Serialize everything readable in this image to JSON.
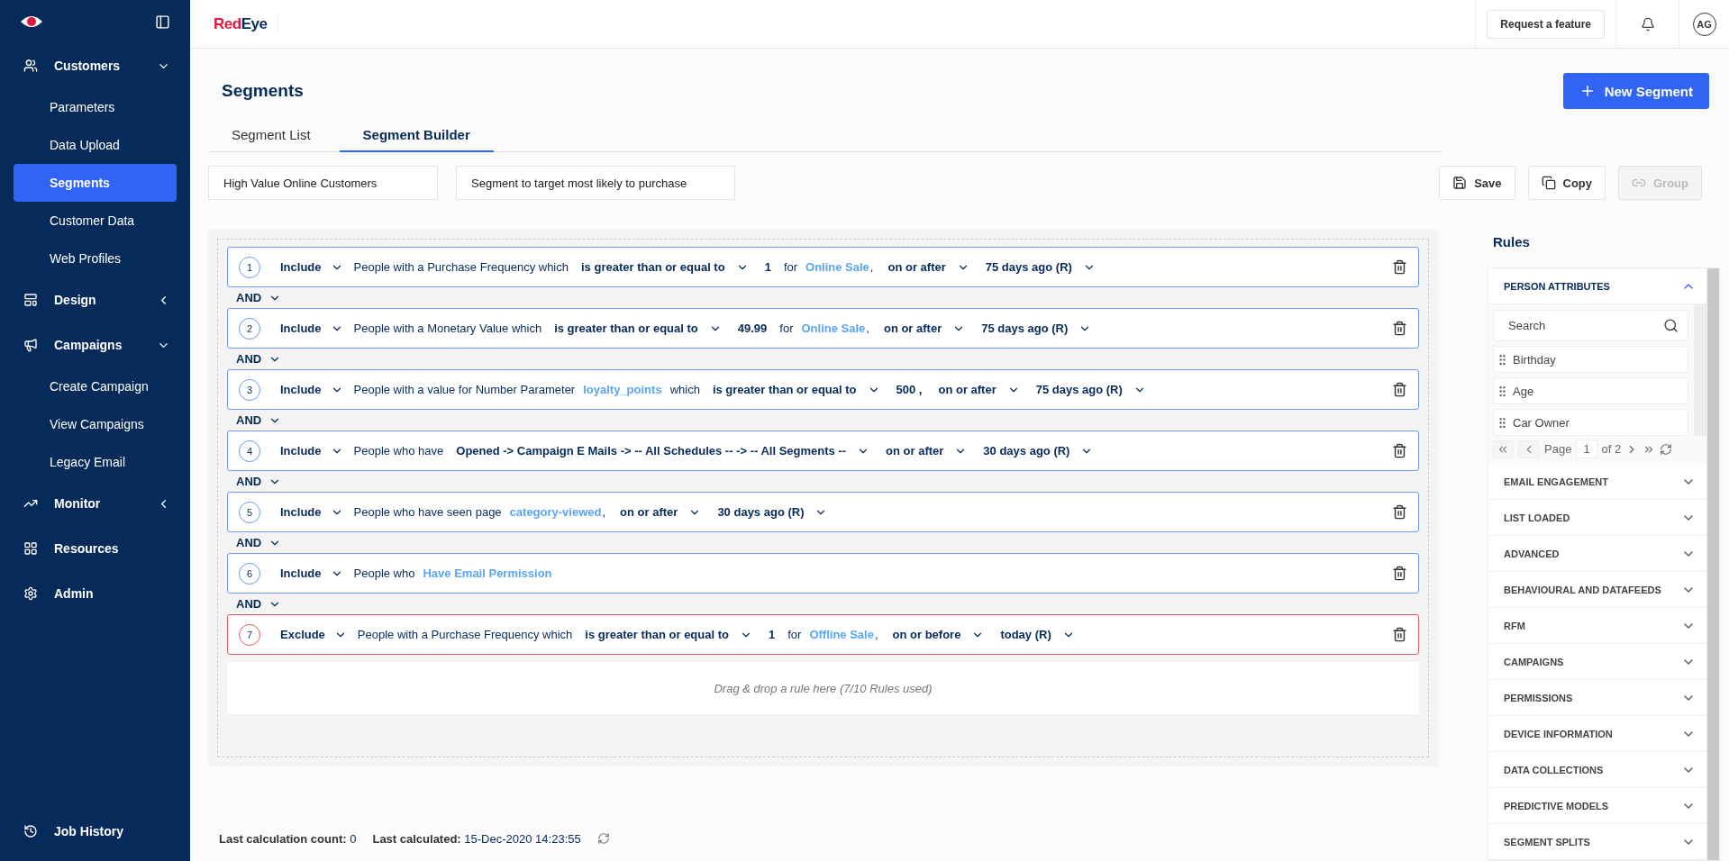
{
  "sidebar": {
    "sections": [
      {
        "label": "Customers",
        "expanded": true,
        "children": [
          {
            "label": "Parameters",
            "selected": false
          },
          {
            "label": "Data Upload",
            "selected": false
          },
          {
            "label": "Segments",
            "selected": true
          },
          {
            "label": "Customer Data",
            "selected": false
          },
          {
            "label": "Web Profiles",
            "selected": false
          }
        ]
      },
      {
        "label": "Design",
        "expanded": false
      },
      {
        "label": "Campaigns",
        "expanded": true,
        "children": [
          {
            "label": "Create Campaign",
            "selected": false
          },
          {
            "label": "View Campaigns",
            "selected": false
          },
          {
            "label": "Legacy Email",
            "selected": false
          }
        ]
      },
      {
        "label": "Monitor",
        "expanded": false
      },
      {
        "label": "Resources"
      },
      {
        "label": "Admin"
      }
    ],
    "footer": "Job History"
  },
  "header": {
    "brand": [
      "Red",
      "Eye"
    ],
    "request_button": "Request a feature",
    "avatar": "AG"
  },
  "page": {
    "title": "Segments",
    "new_button": "New Segment",
    "tabs": [
      {
        "label": "Segment List",
        "selected": false
      },
      {
        "label": "Segment Builder",
        "selected": true
      }
    ],
    "name_field": "High Value Online Customers",
    "description_field": "Segment to target most likely to purchase",
    "actions": [
      {
        "label": "Save",
        "disabled": false
      },
      {
        "label": "Copy",
        "disabled": false
      },
      {
        "label": "Group",
        "disabled": true
      }
    ]
  },
  "rules": [
    {
      "number": "1",
      "kind": "include",
      "mode": "Include",
      "join": "AND",
      "parts": [
        {
          "kind": "plain",
          "text": "People with a Purchase Frequency which"
        },
        {
          "kind": "select",
          "text": "is greater than or equal to"
        },
        {
          "kind": "value",
          "text": "1"
        },
        {
          "kind": "plain",
          "text": "for"
        },
        {
          "kind": "link",
          "text": "Online Sale"
        },
        {
          "kind": "punct",
          "text": ","
        },
        {
          "kind": "select",
          "text": "on or after"
        },
        {
          "kind": "select",
          "text": "75 days ago (R)"
        }
      ]
    },
    {
      "number": "2",
      "kind": "include",
      "mode": "Include",
      "join": "AND",
      "parts": [
        {
          "kind": "plain",
          "text": "People with a Monetary Value which"
        },
        {
          "kind": "select",
          "text": "is greater than or equal to"
        },
        {
          "kind": "value",
          "text": "49.99"
        },
        {
          "kind": "plain",
          "text": "for"
        },
        {
          "kind": "link",
          "text": "Online Sale"
        },
        {
          "kind": "punct",
          "text": ","
        },
        {
          "kind": "select",
          "text": "on or after"
        },
        {
          "kind": "select",
          "text": "75 days ago (R)"
        }
      ]
    },
    {
      "number": "3",
      "kind": "include",
      "mode": "Include",
      "join": "AND",
      "parts": [
        {
          "kind": "plain",
          "text": "People with a value for Number Parameter"
        },
        {
          "kind": "link",
          "text": "loyalty_points"
        },
        {
          "kind": "plain",
          "text": "which"
        },
        {
          "kind": "select",
          "text": "is greater than or equal to"
        },
        {
          "kind": "value",
          "text": "500 ,"
        },
        {
          "kind": "select",
          "text": "on or after"
        },
        {
          "kind": "select",
          "text": "75 days ago (R)"
        }
      ]
    },
    {
      "number": "4",
      "kind": "include",
      "mode": "Include",
      "join": "AND",
      "parts": [
        {
          "kind": "plain",
          "text": "People who have"
        },
        {
          "kind": "select",
          "text": "Opened -> Campaign E Mails -> -- All Schedules -- -> -- All Segments --"
        },
        {
          "kind": "select",
          "text": "on or after"
        },
        {
          "kind": "select",
          "text": "30 days ago (R)"
        }
      ]
    },
    {
      "number": "5",
      "kind": "include",
      "mode": "Include",
      "join": "AND",
      "parts": [
        {
          "kind": "plain",
          "text": "People who have seen page"
        },
        {
          "kind": "link",
          "text": "category-viewed"
        },
        {
          "kind": "punct",
          "text": ","
        },
        {
          "kind": "select",
          "text": "on or after"
        },
        {
          "kind": "select",
          "text": "30 days ago (R)"
        }
      ]
    },
    {
      "number": "6",
      "kind": "include",
      "mode": "Include",
      "join": "AND",
      "parts": [
        {
          "kind": "plain",
          "text": "People who"
        },
        {
          "kind": "link",
          "text": "Have Email Permission"
        }
      ]
    },
    {
      "number": "7",
      "kind": "exclude",
      "mode": "Exclude",
      "parts": [
        {
          "kind": "plain",
          "text": "People with a Purchase Frequency which"
        },
        {
          "kind": "select",
          "text": "is greater than or equal to"
        },
        {
          "kind": "value",
          "text": "1"
        },
        {
          "kind": "plain",
          "text": "for"
        },
        {
          "kind": "link",
          "text": "Offline Sale"
        },
        {
          "kind": "punct",
          "text": ","
        },
        {
          "kind": "select",
          "text": "on or before"
        },
        {
          "kind": "select",
          "text": "today (R)"
        }
      ]
    }
  ],
  "drop_hint": "Drag & drop a rule here (7/10 Rules used)",
  "status_bar": {
    "count_label": "Last calculation count:",
    "count": "0",
    "calculated_label": "Last calculated:",
    "calculated": "15-Dec-2020 14:23:55"
  },
  "rules_panel": {
    "title": "Rules",
    "groups": [
      {
        "label": "PERSON ATTRIBUTES",
        "expanded": true,
        "search_placeholder": "Search",
        "items": [
          "Birthday",
          "Age",
          "Car Owner"
        ],
        "page_label": "Page",
        "page": "1",
        "page_total": "of 2"
      },
      {
        "label": "EMAIL ENGAGEMENT",
        "expanded": false
      },
      {
        "label": "LIST LOADED",
        "expanded": false
      },
      {
        "label": "ADVANCED",
        "expanded": false
      },
      {
        "label": "BEHAVIOURAL AND DATAFEEDS",
        "expanded": false
      },
      {
        "label": "RFM",
        "expanded": false
      },
      {
        "label": "CAMPAIGNS",
        "expanded": false
      },
      {
        "label": "PERMISSIONS",
        "expanded": false
      },
      {
        "label": "DEVICE INFORMATION",
        "expanded": false
      },
      {
        "label": "DATA COLLECTIONS",
        "expanded": false
      },
      {
        "label": "PREDICTIVE MODELS",
        "expanded": false
      },
      {
        "label": "SEGMENT SPLITS",
        "expanded": false
      }
    ]
  }
}
